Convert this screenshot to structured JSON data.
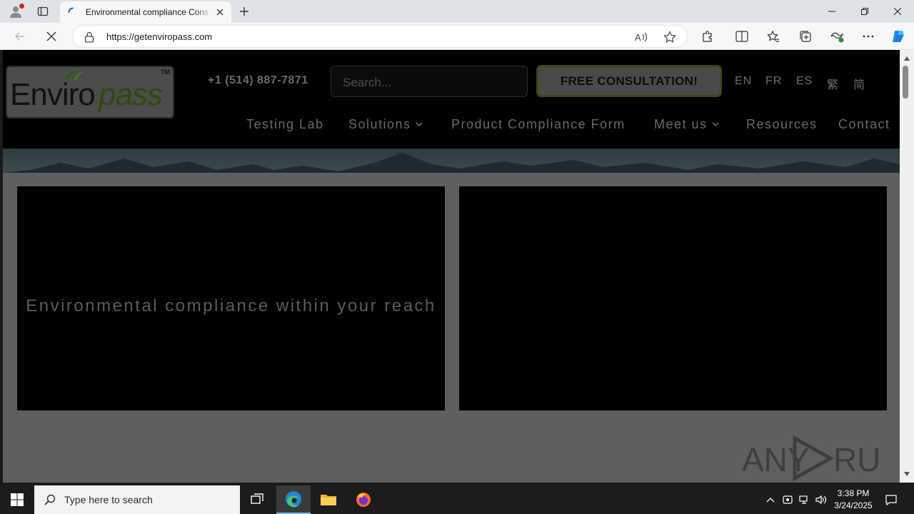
{
  "browser": {
    "tab_title": "Environmental compliance Cons",
    "url": "https://getenviropass.com"
  },
  "site": {
    "logo": {
      "text_enviro": "Enviro",
      "text_pass": "pass",
      "tm": "TM"
    },
    "phone": "+1 (514) 887-7871",
    "search_placeholder": "Search...",
    "cta_label": "FREE CONSULTATION!",
    "languages": [
      "EN",
      "FR",
      "ES",
      "繁",
      "简"
    ],
    "nav": [
      {
        "label": "Testing Lab",
        "dropdown": false
      },
      {
        "label": "Solutions",
        "dropdown": true
      },
      {
        "label": "Product Compliance Form",
        "dropdown": false
      },
      {
        "label": "Meet us",
        "dropdown": true
      },
      {
        "label": "Resources",
        "dropdown": false
      },
      {
        "label": "Contact",
        "dropdown": false
      }
    ],
    "hero_text": "Environmental compliance within your reach"
  },
  "watermark": "ANY RUN",
  "taskbar": {
    "search_placeholder": "Type here to search",
    "time": "3:38 PM",
    "date": "3/24/2025"
  },
  "colors": {
    "accent": "#3a4a10",
    "taskbar_active": "#76b9ed"
  }
}
